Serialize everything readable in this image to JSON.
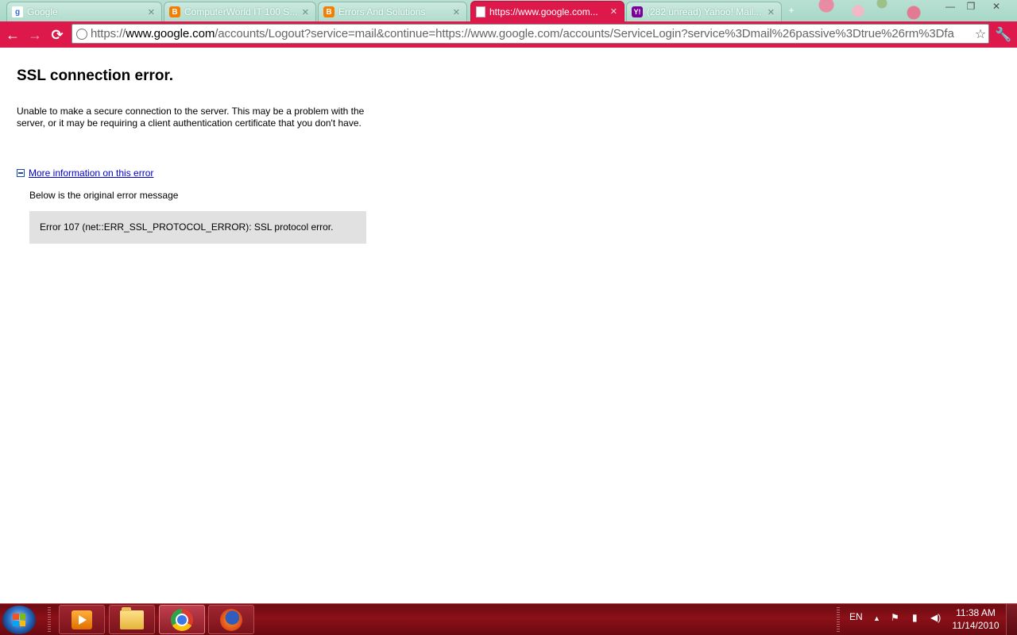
{
  "browser": {
    "tabs": [
      {
        "title": "Google",
        "favicon": "google-favicon-icon",
        "active": false
      },
      {
        "title": "ComputerWorld IT 100 S...",
        "favicon": "blogger-favicon-icon",
        "active": false
      },
      {
        "title": "Errors And Solutions",
        "favicon": "blogger-favicon-icon",
        "active": false
      },
      {
        "title": "https://www.google.com...",
        "favicon": "page-favicon-icon",
        "active": true
      },
      {
        "title": "(282 unread) Yahoo! Mail...",
        "favicon": "yahoo-favicon-icon",
        "active": false
      }
    ],
    "new_tab_label": "+",
    "window_controls": {
      "minimize": "—",
      "restore": "❐",
      "close": "✕"
    },
    "toolbar": {
      "back": "←",
      "forward": "→",
      "reload": "⟳",
      "url_scheme": "https://",
      "url_host": "www.google.com",
      "url_path": "/accounts/Logout?service=mail&continue=https://www.google.com/accounts/ServiceLogin?service%3Dmail%26passive%3Dtrue%26rm%3Dfa",
      "bookmark_star": "☆",
      "wrench": "🔧"
    },
    "accent_color": "#dd184b"
  },
  "page": {
    "title": "SSL connection error.",
    "description": "Unable to make a secure connection to the server. This may be a problem with the server, or it may be requiring a client authentication certificate that you don't have.",
    "more_info_link": "More information on this error",
    "below_text": "Below is the original error message",
    "error_message": "Error 107 (net::ERR_SSL_PROTOCOL_ERROR): SSL protocol error."
  },
  "taskbar": {
    "pinned": [
      {
        "name": "media-player",
        "active": false
      },
      {
        "name": "windows-explorer",
        "active": false
      },
      {
        "name": "google-chrome",
        "active": true
      },
      {
        "name": "firefox",
        "active": false
      }
    ],
    "language": "EN",
    "tray_icons": [
      "show-hidden-icons-icon",
      "action-center-flag-icon",
      "battery-icon",
      "volume-icon"
    ],
    "time": "11:38 AM",
    "date": "11/14/2010"
  }
}
